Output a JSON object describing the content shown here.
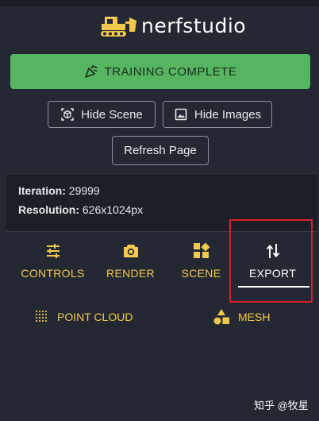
{
  "app": {
    "logo_text": "nerfstudio"
  },
  "status": {
    "label": "TRAINING COMPLETE",
    "icon": "party-popper-icon"
  },
  "buttons": {
    "hide_scene": "Hide Scene",
    "hide_images": "Hide Images",
    "refresh_page": "Refresh Page"
  },
  "info": {
    "iteration_label": "Iteration:",
    "iteration_value": "29999",
    "resolution_label": "Resolution:",
    "resolution_value": "626x1024px"
  },
  "tabs": [
    {
      "label": "CONTROLS",
      "icon": "sliders-icon",
      "active": false
    },
    {
      "label": "RENDER",
      "icon": "camera-icon",
      "active": false
    },
    {
      "label": "SCENE",
      "icon": "widgets-icon",
      "active": false
    },
    {
      "label": "EXPORT",
      "icon": "import-export-icon",
      "active": true
    }
  ],
  "export": {
    "point_cloud": "POINT CLOUD",
    "mesh": "MESH"
  },
  "watermark": "知乎 @牧星",
  "colors": {
    "background": "#242833",
    "success": "#56b561",
    "accent": "#f2c94c",
    "highlight_box": "#d8202a"
  }
}
